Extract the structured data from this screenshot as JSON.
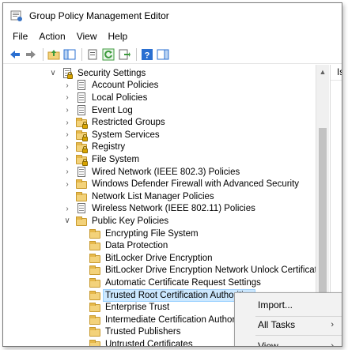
{
  "window": {
    "title": "Group Policy Management Editor"
  },
  "menu": [
    "File",
    "Action",
    "View",
    "Help"
  ],
  "toolbar": {
    "buttons": [
      "back-arrow-icon",
      "forward-arrow-icon",
      "up-folder-icon",
      "show-hide-tree-icon",
      "properties-icon",
      "refresh-icon",
      "export-list-icon",
      "help-icon",
      "show-action-pane-icon"
    ]
  },
  "tree": {
    "items": [
      {
        "label": "Security Settings",
        "expander": "expanded",
        "icon": "security-settings-icon",
        "level": 0
      },
      {
        "label": "Account Policies",
        "expander": "collapsed",
        "icon": "policy-doc-icon",
        "level": 1
      },
      {
        "label": "Local Policies",
        "expander": "collapsed",
        "icon": "policy-doc-icon",
        "level": 1
      },
      {
        "label": "Event Log",
        "expander": "collapsed",
        "icon": "policy-doc-icon",
        "level": 1
      },
      {
        "label": "Restricted Groups",
        "expander": "collapsed",
        "icon": "locked-folder-icon",
        "level": 1
      },
      {
        "label": "System Services",
        "expander": "collapsed",
        "icon": "locked-folder-icon",
        "level": 1
      },
      {
        "label": "Registry",
        "expander": "collapsed",
        "icon": "locked-folder-icon",
        "level": 1
      },
      {
        "label": "File System",
        "expander": "collapsed",
        "icon": "locked-folder-icon",
        "level": 1
      },
      {
        "label": "Wired Network (IEEE 802.3) Policies",
        "expander": "collapsed",
        "icon": "network-policy-icon",
        "level": 1
      },
      {
        "label": "Windows Defender Firewall with Advanced Security",
        "expander": "collapsed",
        "icon": "folder-icon",
        "level": 1
      },
      {
        "label": "Network List Manager Policies",
        "expander": "none",
        "icon": "folder-icon",
        "level": 1
      },
      {
        "label": "Wireless Network (IEEE 802.11) Policies",
        "expander": "collapsed",
        "icon": "network-policy-icon",
        "level": 1
      },
      {
        "label": "Public Key Policies",
        "expander": "expanded",
        "icon": "folder-icon",
        "level": 1
      },
      {
        "label": "Encrypting File System",
        "expander": "none",
        "icon": "folder-icon",
        "level": 2
      },
      {
        "label": "Data Protection",
        "expander": "none",
        "icon": "folder-icon",
        "level": 2
      },
      {
        "label": "BitLocker Drive Encryption",
        "expander": "none",
        "icon": "folder-icon",
        "level": 2
      },
      {
        "label": "BitLocker Drive Encryption Network Unlock Certificate",
        "expander": "none",
        "icon": "folder-icon",
        "level": 2
      },
      {
        "label": "Automatic Certificate Request Settings",
        "expander": "none",
        "icon": "folder-icon",
        "level": 2
      },
      {
        "label": "Trusted Root Certification Authorities",
        "expander": "none",
        "icon": "folder-icon",
        "level": 2,
        "selected": true
      },
      {
        "label": "Enterprise Trust",
        "expander": "none",
        "icon": "folder-icon",
        "level": 2
      },
      {
        "label": "Intermediate Certification Authorities",
        "expander": "none",
        "icon": "folder-icon",
        "level": 2
      },
      {
        "label": "Trusted Publishers",
        "expander": "none",
        "icon": "folder-icon",
        "level": 2
      },
      {
        "label": "Untrusted Certificates",
        "expander": "none",
        "icon": "folder-icon",
        "level": 2
      }
    ]
  },
  "right_pane": {
    "header_fragment": "Is"
  },
  "context_menu": {
    "items": [
      {
        "label": "Import...",
        "submenu": false
      },
      {
        "label": "All Tasks",
        "submenu": true
      },
      {
        "label": "View",
        "submenu": true
      }
    ]
  },
  "colors": {
    "selection_bg": "#cce8ff",
    "selection_border": "#99d1ff",
    "folder_fill": "#f3d27a",
    "toolbar_blue": "#2a6fd1",
    "toolbar_green": "#3c9a3c"
  }
}
